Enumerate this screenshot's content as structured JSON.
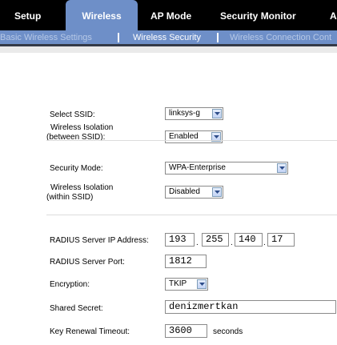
{
  "top_nav": {
    "tabs": [
      "Setup",
      "Wireless",
      "AP Mode",
      "Security Monitor",
      "A"
    ],
    "active": "Wireless"
  },
  "sub_nav": {
    "items": [
      "Basic Wireless Settings",
      "Wireless Security",
      "Wireless Connection Cont"
    ],
    "active": "Wireless Security"
  },
  "form": {
    "select_ssid": {
      "label": "Select SSID:",
      "value": "linksys-g"
    },
    "isolation_between": {
      "label_line1": "Wireless Isolation",
      "label_line2": "(between SSID):",
      "value": "Enabled"
    },
    "security_mode": {
      "label": "Security Mode:",
      "value": "WPA-Enterprise"
    },
    "isolation_within": {
      "label_line1": "Wireless Isolation",
      "label_line2": "(within SSID)",
      "value": "Disabled"
    },
    "radius_ip": {
      "label": "RADIUS Server IP Address:",
      "octets": [
        "193",
        "255",
        "140",
        "17"
      ]
    },
    "radius_port": {
      "label": "RADIUS Server Port:",
      "value": "1812"
    },
    "encryption": {
      "label": "Encryption:",
      "value": "TKIP"
    },
    "shared_secret": {
      "label": "Shared Secret:",
      "value": "denizmertkan"
    },
    "key_renewal": {
      "label": "Key Renewal Timeout:",
      "value": "3600",
      "unit": "seconds"
    }
  },
  "colors": {
    "nav_bg": "#000000",
    "accent": "#6e8fc8",
    "divider": "#dcdcdc"
  },
  "icons": {
    "dropdown": "chevron-down-icon"
  }
}
